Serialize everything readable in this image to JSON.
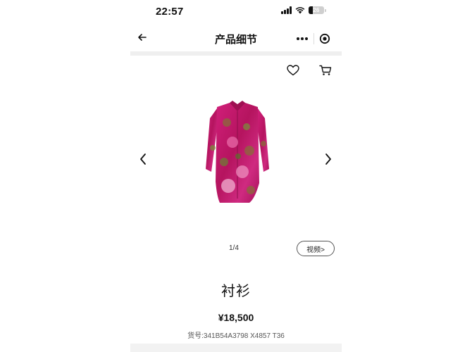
{
  "status_bar": {
    "time": "22:57",
    "battery_level": "26"
  },
  "nav": {
    "title": "产品细节"
  },
  "product": {
    "name": "衬衫",
    "price": "¥18,500",
    "sku": "货号:341B54A3798 X4857 T36",
    "pager": "1/4",
    "video_label": "视频>"
  },
  "icons": [
    "back-arrow-icon",
    "more-dots-icon",
    "close-target-icon",
    "heart-icon",
    "cart-icon",
    "chevron-left-icon",
    "chevron-right-icon"
  ],
  "colors": {
    "accent": "#111111",
    "divider": "#efefef",
    "shirt_primary": "#c2186b"
  }
}
